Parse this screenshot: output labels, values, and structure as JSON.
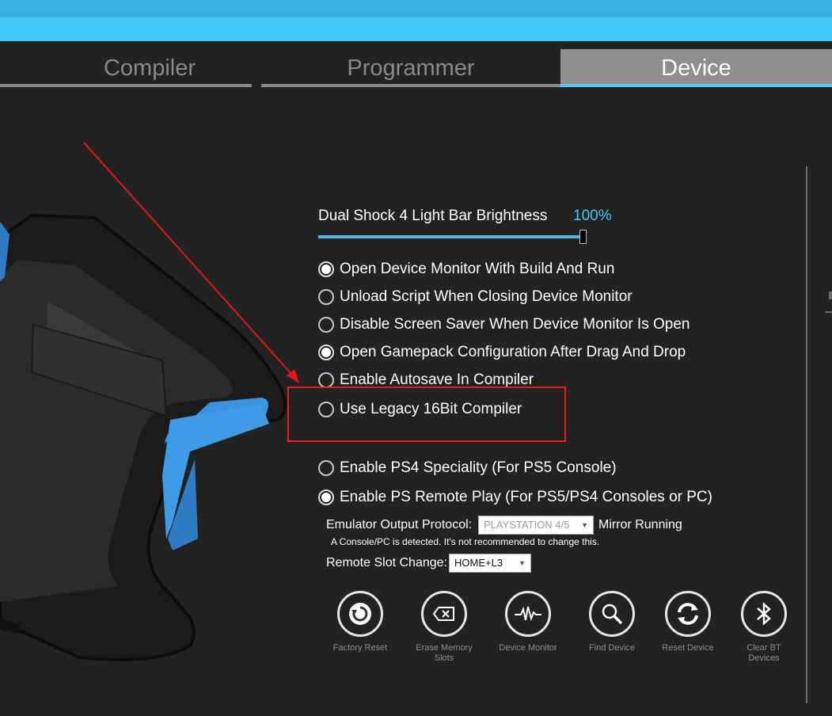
{
  "tabs": [
    {
      "label": "Compiler"
    },
    {
      "label": "Programmer"
    },
    {
      "label": "Device",
      "active": true
    }
  ],
  "brightness": {
    "label": "Dual Shock 4 Light Bar Brightness",
    "value": "100%",
    "level": 1.0
  },
  "options": [
    {
      "label": "Open Device Monitor With Build And Run",
      "checked": true
    },
    {
      "label": "Unload Script When Closing Device Monitor",
      "checked": false
    },
    {
      "label": "Disable Screen Saver When Device Monitor Is Open",
      "checked": false
    },
    {
      "label": "Open Gamepack Configuration After Drag And Drop",
      "checked": true
    },
    {
      "label": "Enable Autosave In Compiler",
      "checked": false
    },
    {
      "label": "Use Legacy 16Bit Compiler",
      "checked": false
    },
    {
      "label": "Enable PS4 Speciality (For PS5 Console)",
      "checked": false
    },
    {
      "label": "Enable PS Remote Play (For PS5/PS4 Consoles or PC)",
      "checked": true
    }
  ],
  "protocol": {
    "label": "Emulator Output Protocol:",
    "value": "PLAYSTATION 4/5",
    "status": "Mirror Running",
    "note": "A Console/PC is detected. It's not recommended to change this."
  },
  "slot": {
    "label": "Remote Slot Change:",
    "value": "HOME+L3"
  },
  "buttons": [
    {
      "label": "Factory Reset",
      "icon": "factory-reset-icon"
    },
    {
      "label": "Erase Memory Slots",
      "icon": "erase-memory-icon"
    },
    {
      "label": "Device Monitor",
      "icon": "pulse-icon"
    },
    {
      "label": "Find Device",
      "icon": "magnifier-icon"
    },
    {
      "label": "Reset Device",
      "icon": "refresh-icon"
    },
    {
      "label": "Clear BT Devices",
      "icon": "bluetooth-icon"
    }
  ],
  "colors": {
    "accent": "#43c9f8",
    "highlight_box": "#e02020",
    "value_text": "#4fc3f7"
  }
}
